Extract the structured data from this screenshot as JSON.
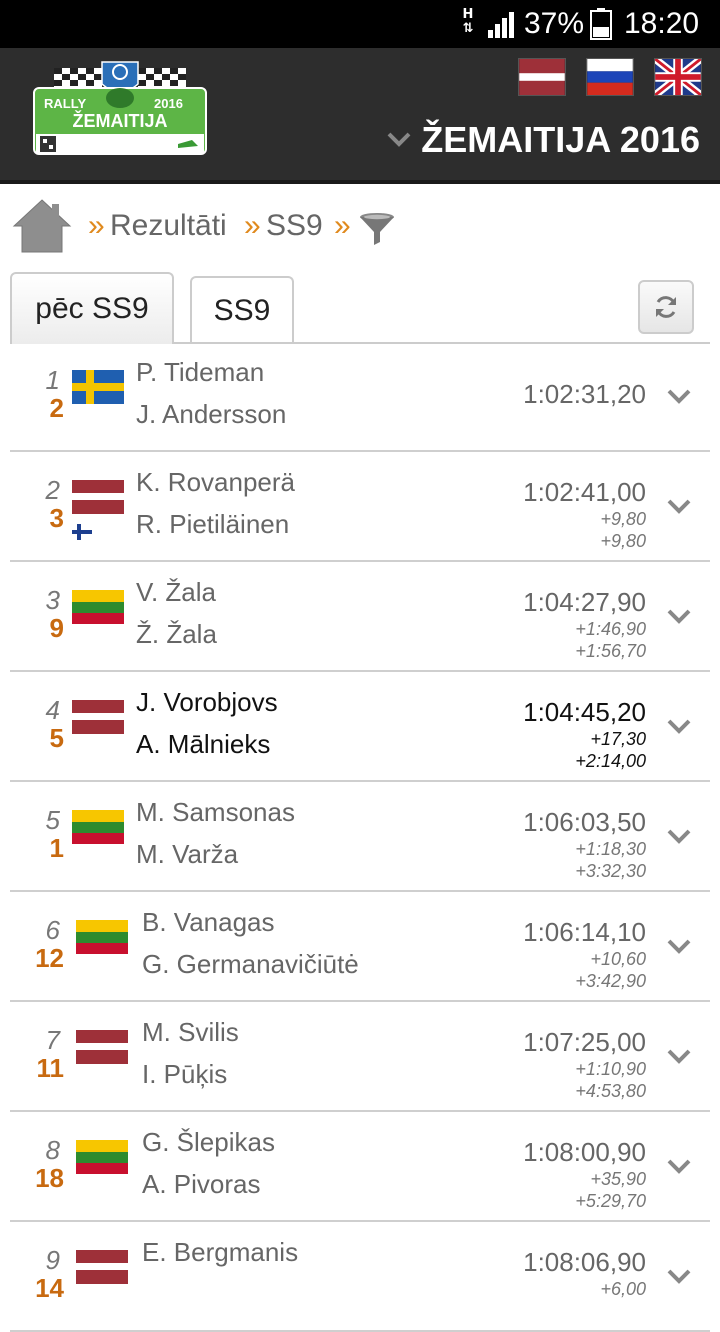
{
  "status_bar": {
    "network": "H",
    "battery_pct": "37%",
    "time": "18:20"
  },
  "header": {
    "logo": {
      "line1": "RALLY",
      "year": "2016",
      "line2": "ŽEMAITIJA"
    },
    "languages": [
      "lv-flag",
      "ru-flag",
      "gb-flag"
    ],
    "event_title": "ŽEMAITIJA 2016"
  },
  "breadcrumb": {
    "sep": "»",
    "items": [
      "Rezultāti",
      "SS9"
    ]
  },
  "tabs": [
    {
      "label": "pēc SS9",
      "active": true
    },
    {
      "label": "SS9",
      "active": false
    }
  ],
  "colors": {
    "accent": "#c86a10",
    "header_bg": "#2d2d2d",
    "logo_green": "#5db546"
  },
  "results": [
    {
      "pos": "1",
      "num": "2",
      "flag": "se",
      "flag2": null,
      "driver": "P. Tideman",
      "codriver": "J. Andersson",
      "time": "1:02:31,20",
      "diff1": "",
      "diff2": "",
      "highlight": false
    },
    {
      "pos": "2",
      "num": "3",
      "flag": "lv",
      "flag2": "fi",
      "driver": "K. Rovanperä",
      "codriver": "R. Pietiläinen",
      "time": "1:02:41,00",
      "diff1": "+9,80",
      "diff2": "+9,80",
      "highlight": false
    },
    {
      "pos": "3",
      "num": "9",
      "flag": "lt",
      "flag2": null,
      "driver": "V. Žala",
      "codriver": "Ž. Žala",
      "time": "1:04:27,90",
      "diff1": "+1:46,90",
      "diff2": "+1:56,70",
      "highlight": false
    },
    {
      "pos": "4",
      "num": "5",
      "flag": "lv",
      "flag2": null,
      "driver": "J. Vorobjovs",
      "codriver": "A. Mālnieks",
      "time": "1:04:45,20",
      "diff1": "+17,30",
      "diff2": "+2:14,00",
      "highlight": true
    },
    {
      "pos": "5",
      "num": "1",
      "flag": "lt",
      "flag2": null,
      "driver": "M. Samsonas",
      "codriver": "M. Varža",
      "time": "1:06:03,50",
      "diff1": "+1:18,30",
      "diff2": "+3:32,30",
      "highlight": false
    },
    {
      "pos": "6",
      "num": "12",
      "flag": "lt",
      "flag2": null,
      "driver": "B. Vanagas",
      "codriver": "G. Germanavičiūtė",
      "time": "1:06:14,10",
      "diff1": "+10,60",
      "diff2": "+3:42,90",
      "highlight": false
    },
    {
      "pos": "7",
      "num": "11",
      "flag": "lv",
      "flag2": null,
      "driver": "M. Svilis",
      "codriver": "I. Pūķis",
      "time": "1:07:25,00",
      "diff1": "+1:10,90",
      "diff2": "+4:53,80",
      "highlight": false
    },
    {
      "pos": "8",
      "num": "18",
      "flag": "lt",
      "flag2": null,
      "driver": "G. Šlepikas",
      "codriver": "A. Pivoras",
      "time": "1:08:00,90",
      "diff1": "+35,90",
      "diff2": "+5:29,70",
      "highlight": false
    },
    {
      "pos": "9",
      "num": "14",
      "flag": "lv",
      "flag2": null,
      "driver": "E. Bergmanis",
      "codriver": "",
      "time": "1:08:06,90",
      "diff1": "+6,00",
      "diff2": "",
      "highlight": false
    }
  ]
}
